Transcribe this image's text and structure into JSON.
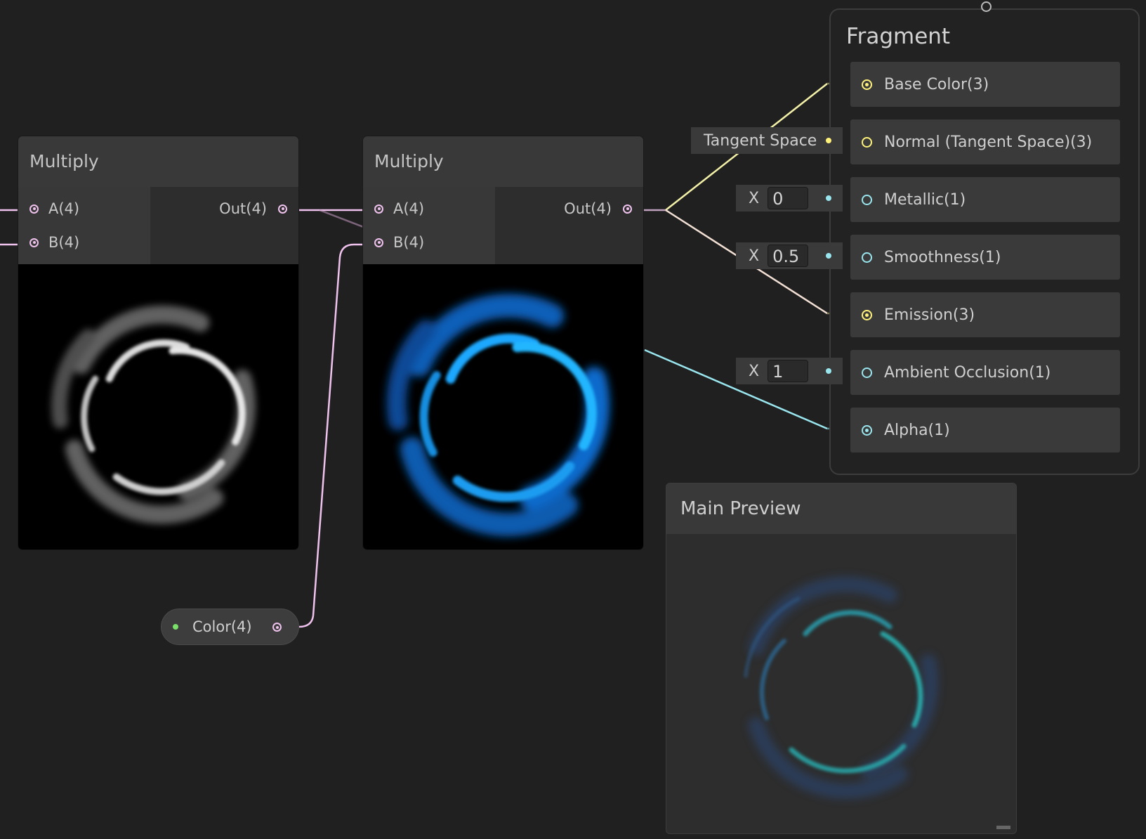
{
  "nodes": {
    "multiply_1": {
      "title": "Multiply",
      "input_a": "A(4)",
      "input_b": "B(4)",
      "output": "Out(4)",
      "preview": "grayscale-swirl"
    },
    "multiply_2": {
      "title": "Multiply",
      "input_a": "A(4)",
      "input_b": "B(4)",
      "output": "Out(4)",
      "preview": "blue-swirl"
    },
    "color_property": {
      "label": "Color(4)"
    }
  },
  "fragment": {
    "title": "Fragment",
    "slots": [
      {
        "label": "Base Color(3)",
        "type": "color"
      },
      {
        "label": "Normal (Tangent Space)(3)",
        "type": "vector"
      },
      {
        "label": "Metallic(1)",
        "type": "float"
      },
      {
        "label": "Smoothness(1)",
        "type": "float"
      },
      {
        "label": "Emission(3)",
        "type": "color"
      },
      {
        "label": "Ambient Occlusion(1)",
        "type": "float"
      },
      {
        "label": "Alpha(1)",
        "type": "float"
      }
    ],
    "inline_inputs": {
      "normal_space": "Tangent Space",
      "metallic": {
        "label": "X",
        "value": "0"
      },
      "smoothness": {
        "label": "X",
        "value": "0.5"
      },
      "ambient_occlusion": {
        "label": "X",
        "value": "1"
      }
    }
  },
  "main_preview": {
    "title": "Main Preview"
  },
  "colors": {
    "background": "#202020",
    "wire_vector4": "#f0c2ee",
    "wire_vector3": "#fff27a",
    "wire_float": "#9ae6ef",
    "node_header": "#393939",
    "swirl_blue": "#0a8cff",
    "swirl_teal": "#28b3a8"
  }
}
